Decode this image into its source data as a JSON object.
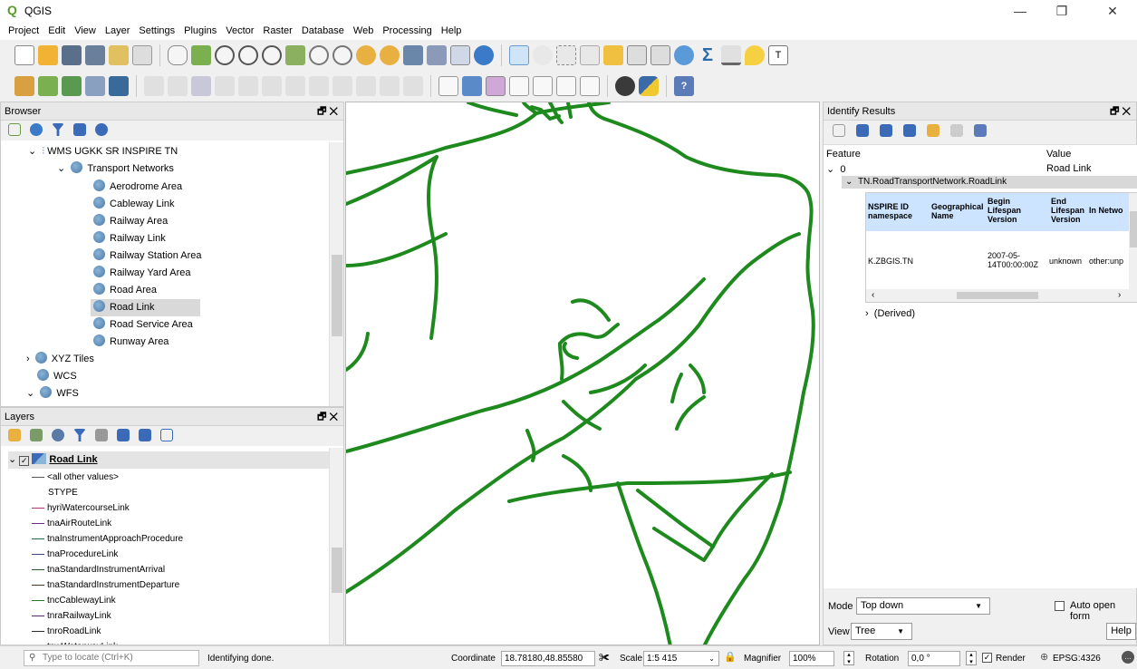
{
  "app": {
    "title": "QGIS"
  },
  "menu": [
    "Project",
    "Edit",
    "View",
    "Layer",
    "Settings",
    "Plugins",
    "Vector",
    "Raster",
    "Database",
    "Web",
    "Processing",
    "Help"
  ],
  "browser": {
    "title": "Browser",
    "items": [
      {
        "label": "WMS UGKK SR INSPIRE TN"
      },
      {
        "label": "Transport Networks"
      },
      {
        "label": "Aerodrome Area"
      },
      {
        "label": "Cableway Link"
      },
      {
        "label": "Railway Area"
      },
      {
        "label": "Railway Link"
      },
      {
        "label": "Railway Station Area"
      },
      {
        "label": "Railway Yard Area"
      },
      {
        "label": "Road Area"
      },
      {
        "label": "Road Link"
      },
      {
        "label": "Road Service Area"
      },
      {
        "label": "Runway Area"
      },
      {
        "label": "XYZ Tiles"
      },
      {
        "label": "WCS"
      },
      {
        "label": "WFS"
      }
    ]
  },
  "layers": {
    "title": "Layers",
    "layer_name": "Road Link",
    "legend": [
      {
        "label": "<all other values>",
        "color": "#555555"
      },
      {
        "label": "STYPE",
        "color": ""
      },
      {
        "label": "hyriWatercourseLink",
        "color": "#b03070"
      },
      {
        "label": "tnaAirRouteLink",
        "color": "#6a2a8a"
      },
      {
        "label": "tnaInstrumentApproachProcedure",
        "color": "#2a6a4a"
      },
      {
        "label": "tnaProcedureLink",
        "color": "#3a4a8a"
      },
      {
        "label": "tnaStandardInstrumentArrival",
        "color": "#2a5a2a"
      },
      {
        "label": "tnaStandardInstrumentDeparture",
        "color": "#4a3a2a"
      },
      {
        "label": "tncCablewayLink",
        "color": "#2a7a2a"
      },
      {
        "label": "tnraRailwayLink",
        "color": "#5a2a6a"
      },
      {
        "label": "tnroRoadLink",
        "color": "#2a2a2a"
      },
      {
        "label": "tnwWaterwayLink",
        "color": "#2a5a8a"
      }
    ]
  },
  "identify": {
    "title": "Identify Results",
    "col_feature": "Feature",
    "col_value": "Value",
    "feature_index": "0",
    "feature_value": "Road Link",
    "group": "TN.RoadTransportNetwork.RoadLink",
    "table_headers": [
      "NSPIRE ID\nnamespace",
      "Geographical\nName",
      "Begin\nLifespan\nVersion",
      "End\nLifespan\nVersion",
      "In Netwo"
    ],
    "table_row": [
      "K.ZBGIS.TN",
      "",
      "2007-05-\n14T00:00:00Z",
      "unknown",
      "other:unp"
    ],
    "derived": "(Derived)",
    "mode_label": "Mode",
    "mode_value": "Top down",
    "view_label": "View",
    "view_value": "Tree",
    "auto_open": "Auto open form",
    "help": "Help"
  },
  "status": {
    "locate_placeholder": "Type to locate (Ctrl+K)",
    "message": "Identifying done.",
    "coordinate_label": "Coordinate",
    "coordinate": "18.78180,48.85580",
    "scale_label": "Scale",
    "scale": "1:5 415",
    "magnifier_label": "Magnifier",
    "magnifier": "100%",
    "rotation_label": "Rotation",
    "rotation": "0,0 °",
    "render_label": "Render",
    "crs": "EPSG:4326"
  },
  "colors": {
    "road": "#1e8a1e",
    "selection": "#cce8ff"
  }
}
